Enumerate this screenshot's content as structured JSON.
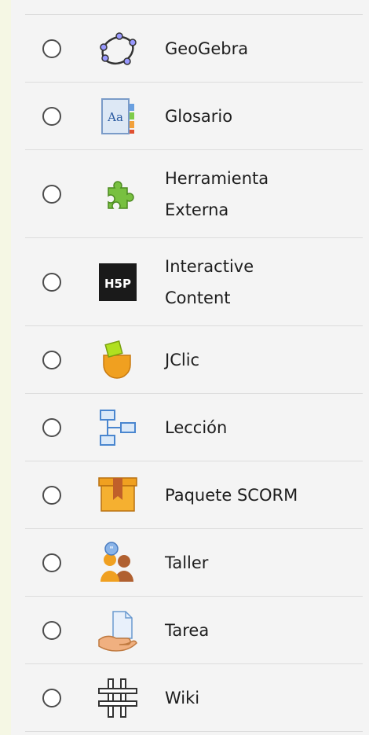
{
  "activities": [
    {
      "id": "geogebra",
      "label": "GeoGebra",
      "icon": "geogebra-icon"
    },
    {
      "id": "glosario",
      "label": "Glosario",
      "icon": "glossary-icon"
    },
    {
      "id": "herramienta-externa",
      "label_line1": "Herramienta",
      "label_line2": "Externa",
      "icon": "puzzle-icon"
    },
    {
      "id": "interactive-content",
      "label_line1": "Interactive",
      "label_line2": "Content",
      "icon": "h5p-icon"
    },
    {
      "id": "jclic",
      "label": "JClic",
      "icon": "jclic-icon"
    },
    {
      "id": "leccion",
      "label": "Lección",
      "icon": "lesson-icon"
    },
    {
      "id": "paquete-scorm",
      "label": "Paquete SCORM",
      "icon": "scorm-package-icon"
    },
    {
      "id": "taller",
      "label": "Taller",
      "icon": "workshop-icon"
    },
    {
      "id": "tarea",
      "label": "Tarea",
      "icon": "assignment-icon"
    },
    {
      "id": "wiki",
      "label": "Wiki",
      "icon": "wiki-icon"
    }
  ],
  "colors": {
    "page_background": "#f5f7e4",
    "panel_background": "#f4f4f4",
    "divider": "#dcdcdc",
    "text": "#1d1d1d"
  }
}
